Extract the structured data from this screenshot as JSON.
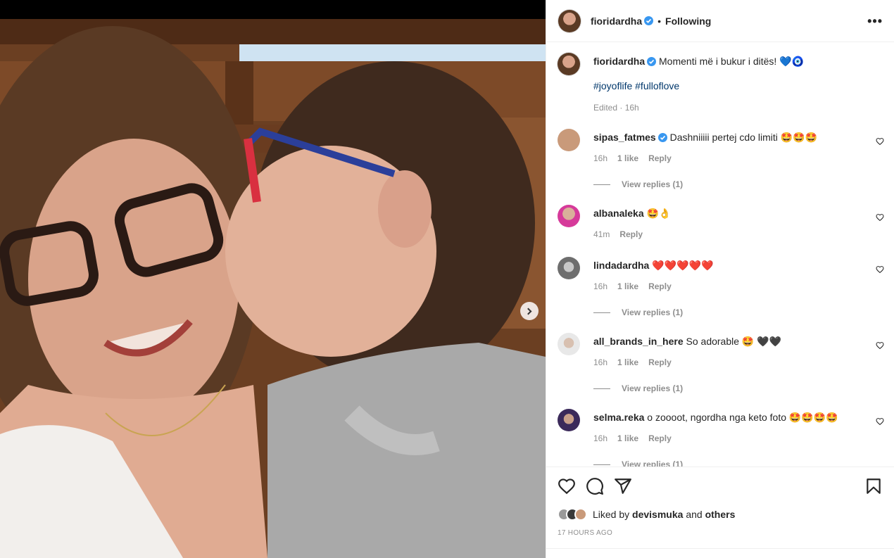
{
  "post": {
    "author": "fioridardha",
    "follow_status": "Following",
    "more": "•••",
    "carousel_dots": 2,
    "carousel_active": 0
  },
  "caption": {
    "username": "fioridardha",
    "text": "Momenti më i bukur i ditës! 💙🧿",
    "hashtags": "#joyoflife #fulloflove",
    "meta": "Edited · 16h"
  },
  "comments": [
    {
      "username": "sipas_fatmes",
      "verified": true,
      "text": "Dashniiiii pertej cdo limiti 🤩🤩🤩",
      "time": "16h",
      "likes": "1 like",
      "reply": "Reply",
      "view_replies": "View replies (1)",
      "avatar_color": "#c99a7a"
    },
    {
      "username": "albanaleka",
      "verified": false,
      "text": "🤩👌",
      "time": "41m",
      "likes": "",
      "reply": "Reply",
      "view_replies": "",
      "avatar_color": "#d63a9a"
    },
    {
      "username": "lindadardha",
      "verified": false,
      "text": "❤️❤️❤️❤️❤️",
      "time": "16h",
      "likes": "1 like",
      "reply": "Reply",
      "view_replies": "View replies (1)",
      "avatar_color": "#8a8a8a"
    },
    {
      "username": "all_brands_in_here",
      "verified": false,
      "text": "So adorable 🤩 🖤🖤",
      "time": "16h",
      "likes": "1 like",
      "reply": "Reply",
      "view_replies": "View replies (1)",
      "avatar_color": "#9a9a9a"
    },
    {
      "username": "selma.reka",
      "verified": false,
      "text": "o zoooot, ngordha nga keto foto 🤩🤩🤩🤩",
      "time": "16h",
      "likes": "1 like",
      "reply": "Reply",
      "view_replies": "View replies (1)",
      "avatar_color": "#3b2a5a"
    }
  ],
  "likes": {
    "prefix": "Liked by",
    "user": "devismuka",
    "and": "and",
    "others": "others"
  },
  "timestamp": "17 HOURS AGO",
  "colors": {
    "verified_blue": "#3897f0",
    "link": "#00376b",
    "muted": "#8e8e8e"
  }
}
